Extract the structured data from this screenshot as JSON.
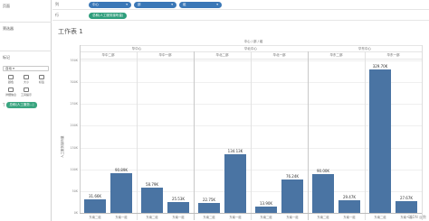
{
  "left": {
    "pages_title": "页面",
    "filters_title": "筛选器",
    "marks_title": "标记",
    "marks_type": "自动",
    "mark_buttons": [
      "颜色",
      "大小",
      "标签",
      "详细信息",
      "工具提示"
    ],
    "measure_pill": "总和(人工服务...)"
  },
  "shelves": {
    "columns_label": "列",
    "rows_label": "行",
    "column_pills": [
      "中心",
      "部",
      "组"
    ],
    "row_pill": "总和(人工服务接听量)"
  },
  "sheet_title": "工作表 1",
  "headers": {
    "top": "中心 / 部 / 组",
    "centers": [
      "华中心",
      "华北中心",
      "华东中心"
    ],
    "depts": [
      "华中二部",
      "华中一部",
      "华北二部",
      "华北一部",
      "华东二部",
      "华东一部"
    ],
    "groups": [
      "东南二组",
      "东南一组"
    ]
  },
  "chart_data": {
    "type": "bar",
    "ylabel": "人工服务接听量",
    "yticks": [
      "0K",
      "50K",
      "100K",
      "150K",
      "200K",
      "250K",
      "300K",
      "350K"
    ],
    "ylim": [
      0,
      350
    ],
    "bars": [
      {
        "value": 31.66,
        "label": "31.66K"
      },
      {
        "value": 90.89,
        "label": "90.89K"
      },
      {
        "value": 58.79,
        "label": "58.79K"
      },
      {
        "value": 25.53,
        "label": "25.53K"
      },
      {
        "value": 22.75,
        "label": "22.75K"
      },
      {
        "value": 134.13,
        "label": "134.13K"
      },
      {
        "value": 13.9,
        "label": "13.90K"
      },
      {
        "value": 76.24,
        "label": "76.24K"
      },
      {
        "value": 90.0,
        "label": "90.00K"
      },
      {
        "value": 29.47,
        "label": "29.47K"
      },
      {
        "value": 329.7,
        "label": "329.70K"
      },
      {
        "value": 27.67,
        "label": "27.67K"
      }
    ],
    "x_labels": [
      "东南二组",
      "东南一组",
      "东南二组",
      "东南一组",
      "东南二组",
      "东南一组",
      "东南二组",
      "东南一组",
      "东南二组",
      "东南一组",
      "东南二组",
      "东南一组"
    ]
  },
  "watermark": "CSDN @数"
}
